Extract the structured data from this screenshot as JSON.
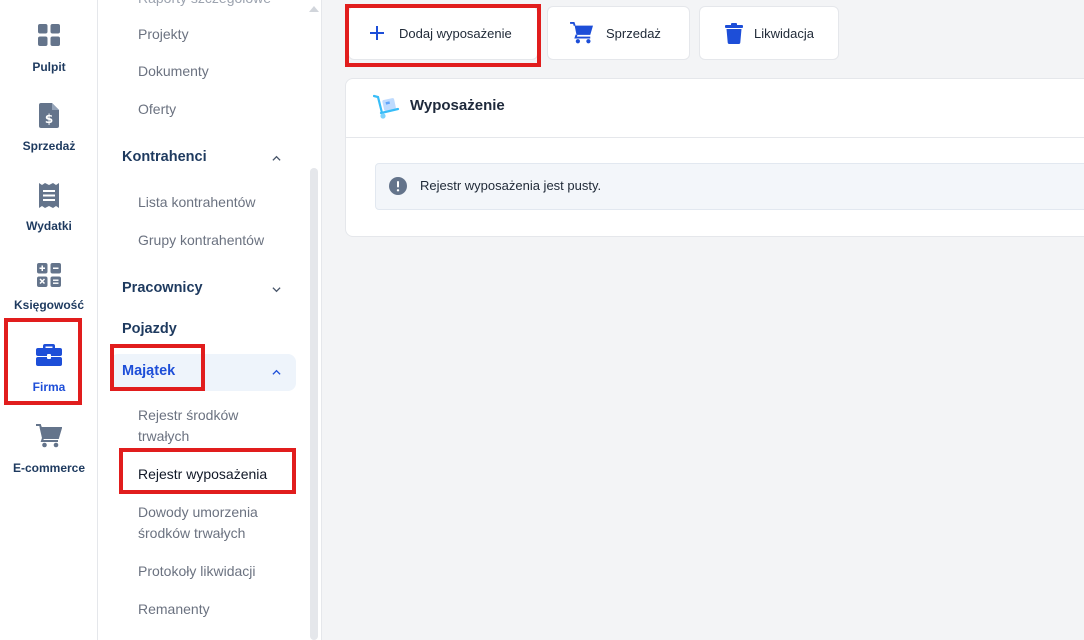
{
  "rail": {
    "items": [
      {
        "label": "Pulpit",
        "icon": "grid-icon"
      },
      {
        "label": "Sprzedaż",
        "icon": "invoice-dollar-icon"
      },
      {
        "label": "Wydatki",
        "icon": "receipt-icon"
      },
      {
        "label": "Księgowość",
        "icon": "calculator-icon"
      },
      {
        "label": "Firma",
        "icon": "briefcase-icon"
      },
      {
        "label": "E-commerce",
        "icon": "cart-icon"
      }
    ],
    "active": "Firma"
  },
  "submenu": {
    "top_cut_label": "Raporty szczegółowe",
    "links_top": [
      "Projekty",
      "Dokumenty",
      "Oferty"
    ],
    "kontrahenci": {
      "label": "Kontrahenci",
      "items": [
        "Lista kontrahentów",
        "Grupy kontrahentów"
      ]
    },
    "pracownicy": {
      "label": "Pracownicy"
    },
    "pojazdy": {
      "label": "Pojazdy"
    },
    "majatek": {
      "label": "Majątek",
      "items": [
        {
          "line1": "Rejestr środków",
          "line2": "trwałych"
        },
        {
          "line1": "Rejestr wyposażenia",
          "line2": ""
        },
        {
          "line1": "Dowody umorzenia",
          "line2": "środków trwałych"
        },
        {
          "line1": "Protokoły likwidacji",
          "line2": ""
        },
        {
          "line1": "Remanenty",
          "line2": ""
        }
      ]
    }
  },
  "toolbar": {
    "add_label": "Dodaj wyposażenie",
    "sale_label": "Sprzedaż",
    "liquidation_label": "Likwidacja"
  },
  "card": {
    "title": "Wyposażenie",
    "empty_message": "Rejestr wyposażenia jest pusty."
  },
  "colors": {
    "accent": "#1d4ed8",
    "highlight": "#e11d1d",
    "nav_text": "#1e3a5f",
    "icon_gray": "#64748b"
  }
}
